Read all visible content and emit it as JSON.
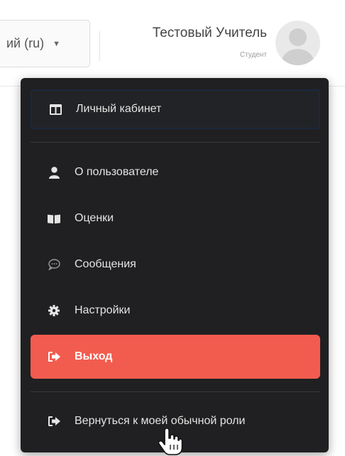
{
  "header": {
    "language_label": "ий (ru)",
    "user_name": "Тестовый Учитель",
    "user_role": "Студент"
  },
  "menu": {
    "items": [
      {
        "label": "Личный кабинет",
        "icon": "dashboard-icon"
      },
      {
        "label": "О пользователе",
        "icon": "user-icon"
      },
      {
        "label": "Оценки",
        "icon": "book-icon"
      },
      {
        "label": "Сообщения",
        "icon": "chat-icon"
      },
      {
        "label": "Настройки",
        "icon": "gear-icon"
      },
      {
        "label": "Выход",
        "icon": "sign-out-icon"
      },
      {
        "label": "Вернуться к моей обычной роли",
        "icon": "sign-out-icon"
      }
    ]
  },
  "colors": {
    "menu_background": "#202022",
    "logout_background": "#f25c4f",
    "focus_border": "#1b2840"
  }
}
